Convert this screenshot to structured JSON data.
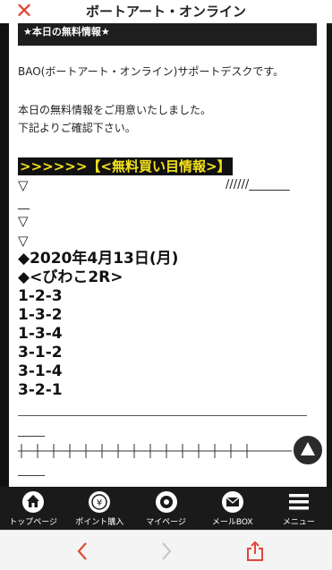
{
  "header": {
    "title": "ボートアート・オンライン"
  },
  "content": {
    "banner": "★本日の無料情報★",
    "intro": "BAO(ボートアート・オンライン)サポートデスクです。",
    "line2": "本日の無料情報をご用意いたしました。",
    "line3": "下記よりご確認下さい。",
    "highlight": ">>>>>>【<無料買い目情報>】",
    "tri1": "▽",
    "slashes": "//////_______",
    "dash": "__",
    "tri2": "▽",
    "tri3": "▽",
    "date": "◆2020年4月13日(月)",
    "race": "◆<びわこ2R>",
    "picks": [
      "1-2-3",
      "1-3-2",
      "1-3-4",
      "3-1-2",
      "3-1-4",
      "3-2-1"
    ],
    "rule_dash_a": "_____",
    "rule_dash_b": "_____"
  },
  "nav": {
    "items": [
      {
        "label": "トップページ",
        "icon": "home-icon"
      },
      {
        "label": "ポイント購入",
        "icon": "coin-icon"
      },
      {
        "label": "マイページ",
        "icon": "gear-icon"
      },
      {
        "label": "メールBOX",
        "icon": "mail-icon"
      },
      {
        "label": "メニュー",
        "icon": "menu-icon"
      }
    ]
  },
  "colors": {
    "accent_red": "#e0473a",
    "highlight_text": "#f5e21a",
    "nav_bg": "#1a1a1a"
  }
}
